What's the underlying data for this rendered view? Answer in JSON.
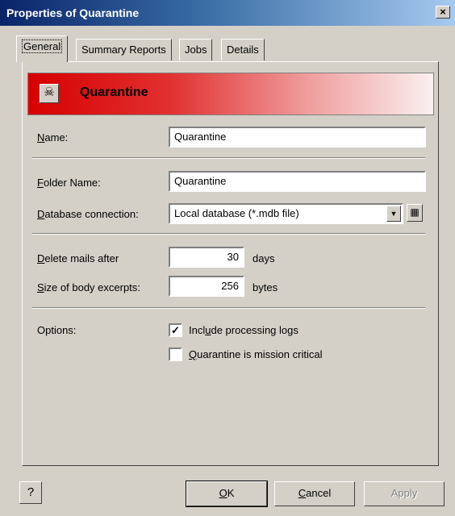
{
  "window": {
    "title": "Properties of Quarantine",
    "close_glyph": "×"
  },
  "tabs": [
    {
      "label": "General",
      "active": true
    },
    {
      "label": "Summary Reports",
      "active": false
    },
    {
      "label": "Jobs",
      "active": false
    },
    {
      "label": "Details",
      "active": false
    }
  ],
  "banner": {
    "icon": "skull-crossbones-icon",
    "icon_glyph": "☠",
    "title": "Quarantine",
    "gradient_start": "#d70000",
    "gradient_end": "#fbf0f0"
  },
  "form": {
    "name": {
      "label_first": "N",
      "label_rest": "ame:",
      "value": "Quarantine"
    },
    "folder_name": {
      "label_first": "F",
      "label_rest": "older Name:",
      "value": "Quarantine"
    },
    "database_connection": {
      "label_first": "D",
      "label_rest": "atabase connection:",
      "value": "Local database (*.mdb file)"
    },
    "delete_mails_after": {
      "label_first": "D",
      "label_rest": "elete mails after",
      "value": "30",
      "unit": "days"
    },
    "size_of_body_excerpts": {
      "label_first": "S",
      "label_rest": "ize of body excerpts:",
      "value": "256",
      "unit": "bytes"
    },
    "options_label": "Options:",
    "options": [
      {
        "label_before": "Incl",
        "label_u": "u",
        "label_after": "de processing logs",
        "checked": true
      },
      {
        "label_before": "",
        "label_u": "Q",
        "label_after": "uarantine is mission critical",
        "checked": false
      }
    ]
  },
  "buttons": {
    "help_icon": "help-icon",
    "help_glyph": "?",
    "ok_u": "O",
    "ok_rest": "K",
    "cancel_u": "C",
    "cancel_rest": "ancel",
    "apply": "Apply",
    "apply_enabled": false
  },
  "colors": {
    "titlebar_start": "#0a246a",
    "dialog_bg": "#d4d0c8"
  }
}
